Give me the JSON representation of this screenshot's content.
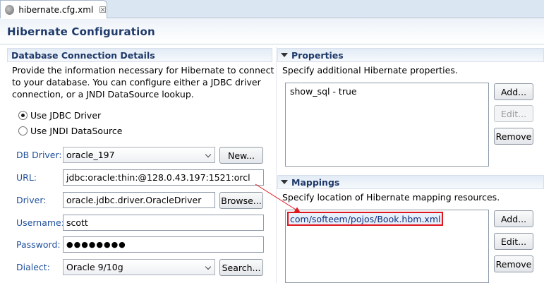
{
  "editor_tab": {
    "title": "hibernate.cfg.xml",
    "close": "☒"
  },
  "page_title": "Hibernate  Configuration",
  "db_section": {
    "title": "Database Connection Details",
    "description_lines": [
      "Provide the information necessary for Hibernate to connect",
      "to your database.  You can configure either a JDBC driver",
      "connection, or a JNDI DataSource lookup."
    ],
    "radio_jdbc": "Use JDBC Driver",
    "radio_jndi": "Use JNDI DataSource",
    "selected_mode": "jdbc",
    "fields": {
      "db_driver": {
        "label": "DB Driver:",
        "value": "oracle_197",
        "button": "New..."
      },
      "url": {
        "label": "URL:",
        "value": "jdbc:oracle:thin:@128.0.43.197:1521:orcl"
      },
      "driver": {
        "label": "Driver:",
        "value": "oracle.jdbc.driver.OracleDriver",
        "button": "Browse..."
      },
      "username": {
        "label": "Username:",
        "value": "scott"
      },
      "password": {
        "label": "Password:",
        "value": "●●●●●●●●"
      },
      "dialect": {
        "label": "Dialect:",
        "value": "Oracle 9/10g",
        "button": "Search..."
      }
    }
  },
  "properties_section": {
    "title": "Properties",
    "description": "Specify additional Hibernate properties.",
    "items": [
      "show_sql - true"
    ],
    "buttons": {
      "add": "Add...",
      "edit": "Edit...",
      "remove": "Remove"
    }
  },
  "mappings_section": {
    "title": "Mappings",
    "description": "Specify location of Hibernate mapping resources.",
    "items": [
      "com/softeem/pojos/Book.hbm.xml"
    ],
    "buttons": {
      "add": "Add...",
      "edit": "Edit...",
      "remove": "Remove"
    }
  },
  "colors": {
    "accent_title": "#1f3a6a",
    "label_blue": "#21519e",
    "annotation_red": "#e0161d"
  }
}
